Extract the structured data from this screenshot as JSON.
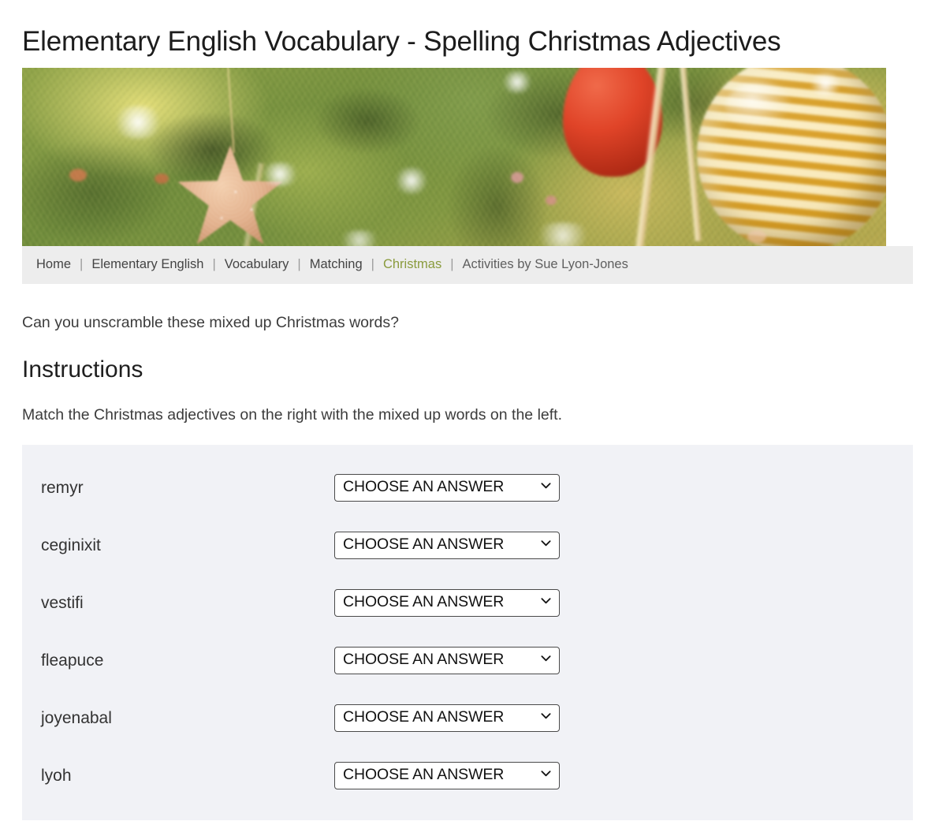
{
  "page_title": "Elementary English Vocabulary - Spelling Christmas Adjectives",
  "hero": {
    "alt": "Close-up of a decorated Christmas tree with a gold glitter star, a red bauble and a large gold striped glass bauble",
    "icon": "christmas-tree-photo"
  },
  "breadcrumb": {
    "items": [
      {
        "label": "Home",
        "state": "link"
      },
      {
        "label": "Elementary English",
        "state": "link"
      },
      {
        "label": "Vocabulary",
        "state": "link"
      },
      {
        "label": "Matching",
        "state": "link"
      },
      {
        "label": "Christmas",
        "state": "active"
      },
      {
        "label": "Activities by Sue Lyon-Jones",
        "state": "muted"
      }
    ],
    "separator": "|",
    "active_color": "#8a9b3d",
    "link_color": "#444444",
    "background": "#ededed"
  },
  "intro": "Can you unscramble these mixed up Christmas words?",
  "section_heading": "Instructions",
  "instructions": "Match the Christmas adjectives on the right with the mixed up words on the left.",
  "quiz": {
    "background": "#f1f2f6",
    "select_placeholder": "CHOOSE AN ANSWER",
    "chevron_icon": "chevron-down-icon",
    "rows": [
      {
        "word": "remyr",
        "answer": "CHOOSE AN ANSWER"
      },
      {
        "word": "ceginixit",
        "answer": "CHOOSE AN ANSWER"
      },
      {
        "word": "vestifi",
        "answer": "CHOOSE AN ANSWER"
      },
      {
        "word": "fleapuce",
        "answer": "CHOOSE AN ANSWER"
      },
      {
        "word": "joyenabal",
        "answer": "CHOOSE AN ANSWER"
      },
      {
        "word": "lyoh",
        "answer": "CHOOSE AN ANSWER"
      }
    ]
  }
}
